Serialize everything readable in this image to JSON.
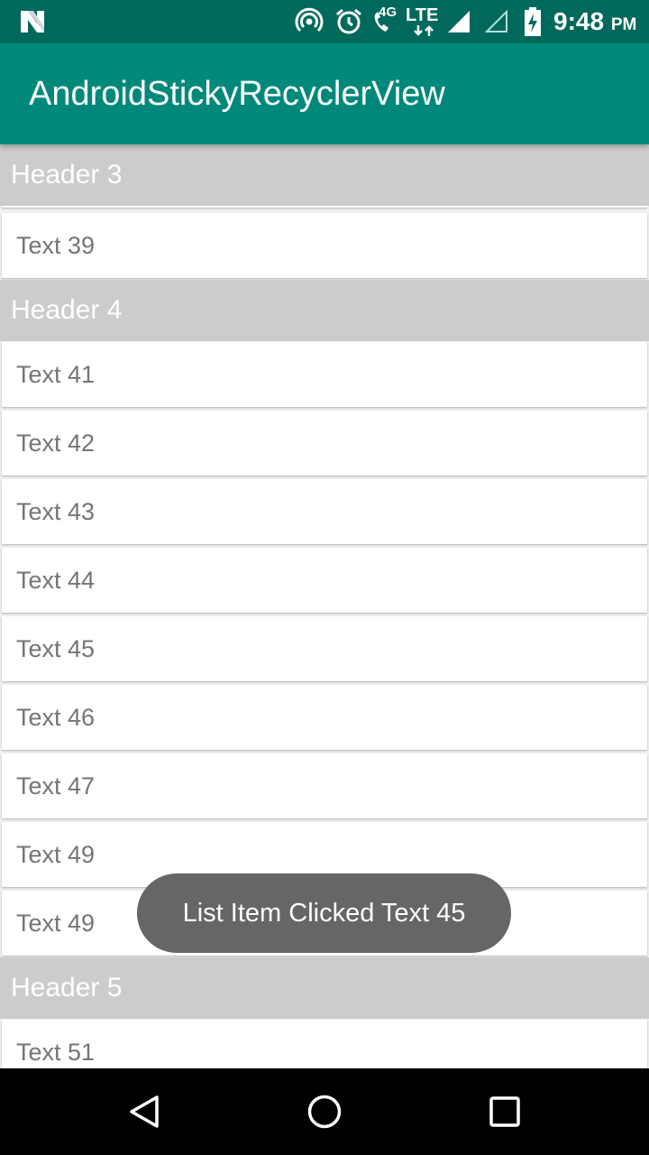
{
  "status_bar": {
    "time": "9:48",
    "ampm": "PM",
    "network_small": "4G",
    "network": "LTE",
    "icons": [
      "n-logo-icon",
      "hotspot-icon",
      "alarm-icon",
      "wifi-call-icon",
      "signal-icon",
      "signal-empty-icon",
      "battery-charging-icon"
    ]
  },
  "app_bar": {
    "title": "AndroidStickyRecyclerView",
    "color": "#00897b"
  },
  "list": {
    "sticky_header": "Header 3",
    "partial_top_item": "Text 39",
    "sections": [
      {
        "header": "Header 4",
        "items": [
          "Text 41",
          "Text 42",
          "Text 43",
          "Text 44",
          "Text 45",
          "Text 46",
          "Text 47",
          "Text 49",
          "Text 49"
        ]
      },
      {
        "header": "Header 5",
        "items": [
          "Text 51"
        ]
      }
    ]
  },
  "toast": {
    "message": "List Item Clicked  Text 45"
  },
  "nav_bar": {
    "buttons": [
      "back-icon",
      "home-icon",
      "recents-icon"
    ]
  },
  "colors": {
    "status_bar": "#00695c",
    "header_bg": "#cccccc",
    "item_text": "#757575",
    "toast_bg": "#666666"
  }
}
